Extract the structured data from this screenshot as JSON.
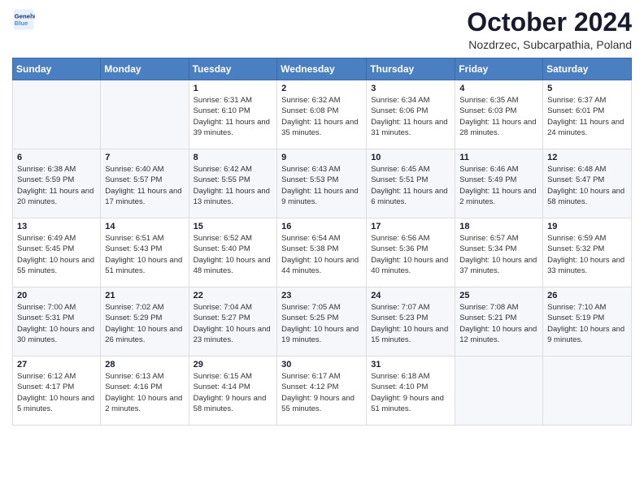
{
  "logo": {
    "line1": "General",
    "line2": "Blue"
  },
  "header": {
    "month": "October 2024",
    "location": "Nozdrzec, Subcarpathia, Poland"
  },
  "weekdays": [
    "Sunday",
    "Monday",
    "Tuesday",
    "Wednesday",
    "Thursday",
    "Friday",
    "Saturday"
  ],
  "weeks": [
    [
      {
        "day": "",
        "sunrise": "",
        "sunset": "",
        "daylight": ""
      },
      {
        "day": "",
        "sunrise": "",
        "sunset": "",
        "daylight": ""
      },
      {
        "day": "1",
        "sunrise": "Sunrise: 6:31 AM",
        "sunset": "Sunset: 6:10 PM",
        "daylight": "Daylight: 11 hours and 39 minutes."
      },
      {
        "day": "2",
        "sunrise": "Sunrise: 6:32 AM",
        "sunset": "Sunset: 6:08 PM",
        "daylight": "Daylight: 11 hours and 35 minutes."
      },
      {
        "day": "3",
        "sunrise": "Sunrise: 6:34 AM",
        "sunset": "Sunset: 6:06 PM",
        "daylight": "Daylight: 11 hours and 31 minutes."
      },
      {
        "day": "4",
        "sunrise": "Sunrise: 6:35 AM",
        "sunset": "Sunset: 6:03 PM",
        "daylight": "Daylight: 11 hours and 28 minutes."
      },
      {
        "day": "5",
        "sunrise": "Sunrise: 6:37 AM",
        "sunset": "Sunset: 6:01 PM",
        "daylight": "Daylight: 11 hours and 24 minutes."
      }
    ],
    [
      {
        "day": "6",
        "sunrise": "Sunrise: 6:38 AM",
        "sunset": "Sunset: 5:59 PM",
        "daylight": "Daylight: 11 hours and 20 minutes."
      },
      {
        "day": "7",
        "sunrise": "Sunrise: 6:40 AM",
        "sunset": "Sunset: 5:57 PM",
        "daylight": "Daylight: 11 hours and 17 minutes."
      },
      {
        "day": "8",
        "sunrise": "Sunrise: 6:42 AM",
        "sunset": "Sunset: 5:55 PM",
        "daylight": "Daylight: 11 hours and 13 minutes."
      },
      {
        "day": "9",
        "sunrise": "Sunrise: 6:43 AM",
        "sunset": "Sunset: 5:53 PM",
        "daylight": "Daylight: 11 hours and 9 minutes."
      },
      {
        "day": "10",
        "sunrise": "Sunrise: 6:45 AM",
        "sunset": "Sunset: 5:51 PM",
        "daylight": "Daylight: 11 hours and 6 minutes."
      },
      {
        "day": "11",
        "sunrise": "Sunrise: 6:46 AM",
        "sunset": "Sunset: 5:49 PM",
        "daylight": "Daylight: 11 hours and 2 minutes."
      },
      {
        "day": "12",
        "sunrise": "Sunrise: 6:48 AM",
        "sunset": "Sunset: 5:47 PM",
        "daylight": "Daylight: 10 hours and 58 minutes."
      }
    ],
    [
      {
        "day": "13",
        "sunrise": "Sunrise: 6:49 AM",
        "sunset": "Sunset: 5:45 PM",
        "daylight": "Daylight: 10 hours and 55 minutes."
      },
      {
        "day": "14",
        "sunrise": "Sunrise: 6:51 AM",
        "sunset": "Sunset: 5:43 PM",
        "daylight": "Daylight: 10 hours and 51 minutes."
      },
      {
        "day": "15",
        "sunrise": "Sunrise: 6:52 AM",
        "sunset": "Sunset: 5:40 PM",
        "daylight": "Daylight: 10 hours and 48 minutes."
      },
      {
        "day": "16",
        "sunrise": "Sunrise: 6:54 AM",
        "sunset": "Sunset: 5:38 PM",
        "daylight": "Daylight: 10 hours and 44 minutes."
      },
      {
        "day": "17",
        "sunrise": "Sunrise: 6:56 AM",
        "sunset": "Sunset: 5:36 PM",
        "daylight": "Daylight: 10 hours and 40 minutes."
      },
      {
        "day": "18",
        "sunrise": "Sunrise: 6:57 AM",
        "sunset": "Sunset: 5:34 PM",
        "daylight": "Daylight: 10 hours and 37 minutes."
      },
      {
        "day": "19",
        "sunrise": "Sunrise: 6:59 AM",
        "sunset": "Sunset: 5:32 PM",
        "daylight": "Daylight: 10 hours and 33 minutes."
      }
    ],
    [
      {
        "day": "20",
        "sunrise": "Sunrise: 7:00 AM",
        "sunset": "Sunset: 5:31 PM",
        "daylight": "Daylight: 10 hours and 30 minutes."
      },
      {
        "day": "21",
        "sunrise": "Sunrise: 7:02 AM",
        "sunset": "Sunset: 5:29 PM",
        "daylight": "Daylight: 10 hours and 26 minutes."
      },
      {
        "day": "22",
        "sunrise": "Sunrise: 7:04 AM",
        "sunset": "Sunset: 5:27 PM",
        "daylight": "Daylight: 10 hours and 23 minutes."
      },
      {
        "day": "23",
        "sunrise": "Sunrise: 7:05 AM",
        "sunset": "Sunset: 5:25 PM",
        "daylight": "Daylight: 10 hours and 19 minutes."
      },
      {
        "day": "24",
        "sunrise": "Sunrise: 7:07 AM",
        "sunset": "Sunset: 5:23 PM",
        "daylight": "Daylight: 10 hours and 15 minutes."
      },
      {
        "day": "25",
        "sunrise": "Sunrise: 7:08 AM",
        "sunset": "Sunset: 5:21 PM",
        "daylight": "Daylight: 10 hours and 12 minutes."
      },
      {
        "day": "26",
        "sunrise": "Sunrise: 7:10 AM",
        "sunset": "Sunset: 5:19 PM",
        "daylight": "Daylight: 10 hours and 9 minutes."
      }
    ],
    [
      {
        "day": "27",
        "sunrise": "Sunrise: 6:12 AM",
        "sunset": "Sunset: 4:17 PM",
        "daylight": "Daylight: 10 hours and 5 minutes."
      },
      {
        "day": "28",
        "sunrise": "Sunrise: 6:13 AM",
        "sunset": "Sunset: 4:16 PM",
        "daylight": "Daylight: 10 hours and 2 minutes."
      },
      {
        "day": "29",
        "sunrise": "Sunrise: 6:15 AM",
        "sunset": "Sunset: 4:14 PM",
        "daylight": "Daylight: 9 hours and 58 minutes."
      },
      {
        "day": "30",
        "sunrise": "Sunrise: 6:17 AM",
        "sunset": "Sunset: 4:12 PM",
        "daylight": "Daylight: 9 hours and 55 minutes."
      },
      {
        "day": "31",
        "sunrise": "Sunrise: 6:18 AM",
        "sunset": "Sunset: 4:10 PM",
        "daylight": "Daylight: 9 hours and 51 minutes."
      },
      {
        "day": "",
        "sunrise": "",
        "sunset": "",
        "daylight": ""
      },
      {
        "day": "",
        "sunrise": "",
        "sunset": "",
        "daylight": ""
      }
    ]
  ]
}
